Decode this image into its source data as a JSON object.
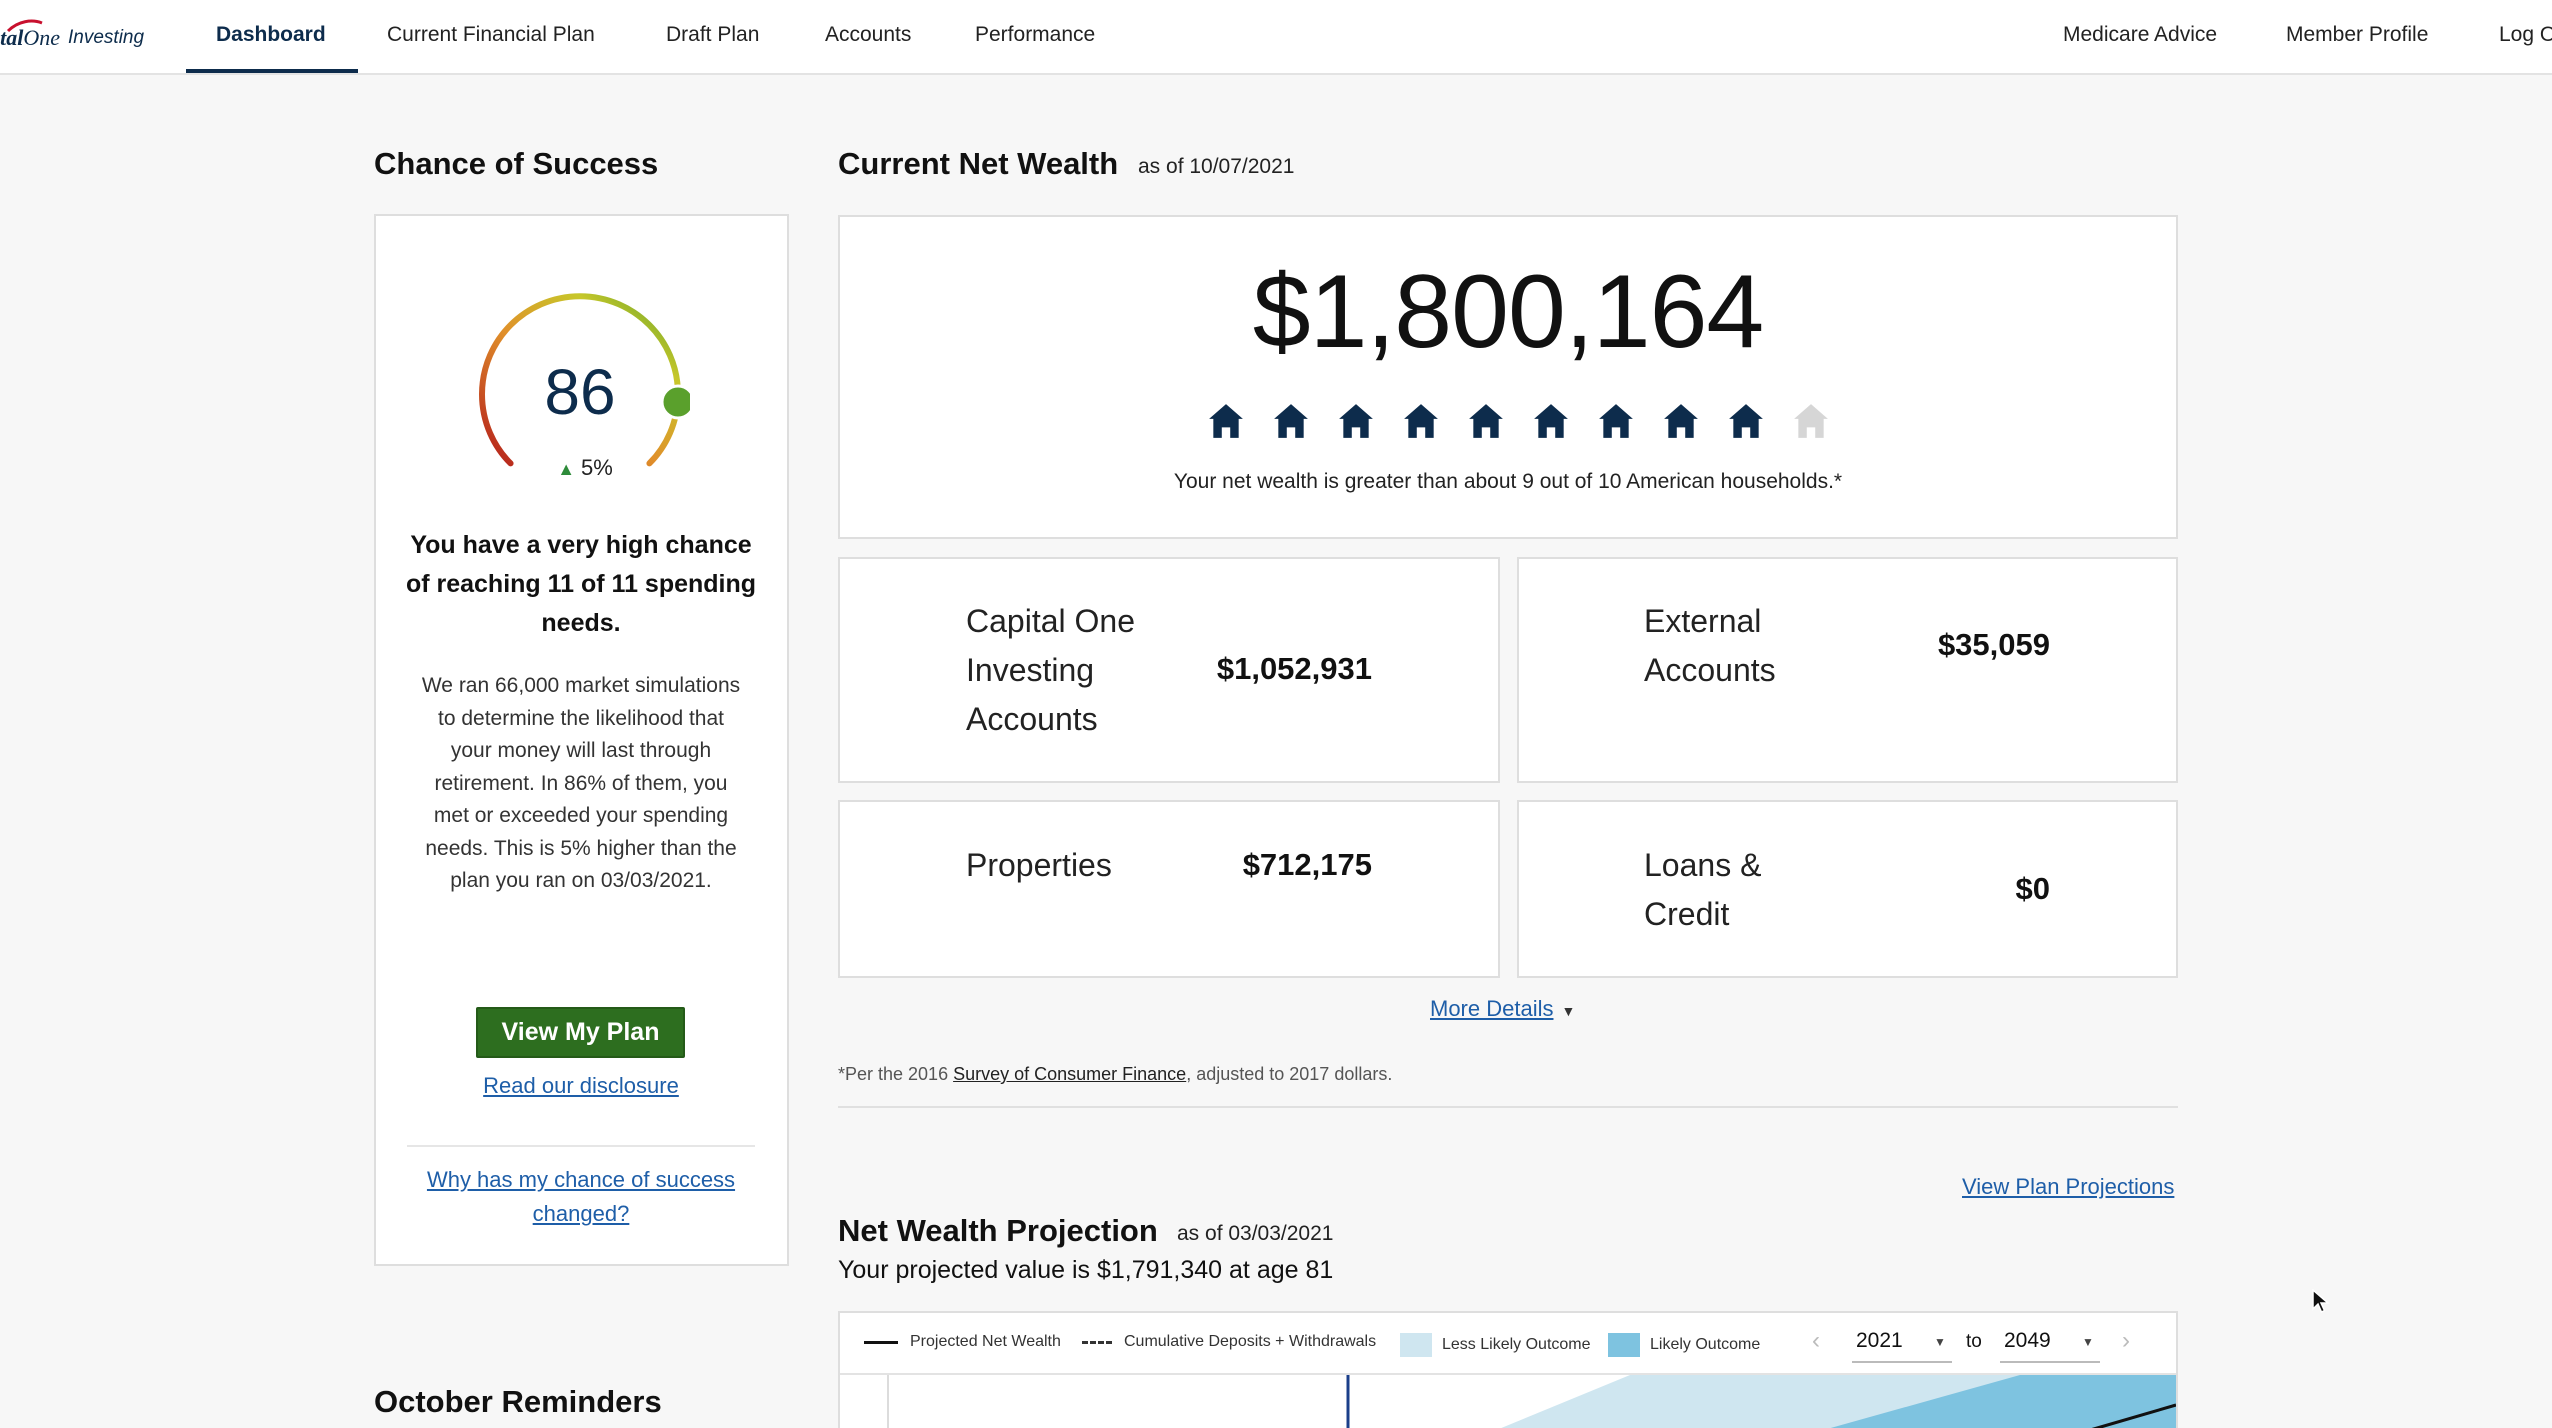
{
  "brand": {
    "logo_mark": "ital",
    "logo_mark2": "One",
    "logo_sub": "Investing"
  },
  "nav": {
    "items": [
      {
        "label": "Dashboard",
        "active": true
      },
      {
        "label": "Current Financial Plan"
      },
      {
        "label": "Draft Plan"
      },
      {
        "label": "Accounts"
      },
      {
        "label": "Performance"
      }
    ],
    "right_items": [
      {
        "label": "Medicare Advice"
      },
      {
        "label": "Member Profile"
      },
      {
        "label": "Log O"
      }
    ]
  },
  "success": {
    "title": "Chance of Success",
    "score": "86",
    "score_fraction": 0.86,
    "delta": "5%",
    "headline": "You have a very high chance of reaching 11 of 11 spending needs.",
    "body": "We ran 66,000 market simulations to determine the likelihood that your money will last through retirement. In 86% of them, you met or exceeded your spending needs. This is 5% higher than the plan you ran on 03/03/2021.",
    "button": "View My Plan",
    "disclosure_link": "Read our disclosure",
    "why_link": "Why has my chance of success changed?"
  },
  "net_wealth": {
    "title": "Current Net Wealth",
    "as_of": "as of 10/07/2021",
    "amount": "$1,800,164",
    "houses_filled": 9,
    "houses_total": 10,
    "note": "Your net wealth is greater than about 9 out of 10 American households.*",
    "tiles": [
      {
        "label": "Capital One Investing Accounts",
        "value": "$1,052,931"
      },
      {
        "label": "External Accounts",
        "value": "$35,059"
      },
      {
        "label": "Properties",
        "value": "$712,175"
      },
      {
        "label": "Loans & Credit",
        "value": "$0"
      }
    ],
    "more_details": "More Details",
    "footnote_pre": "*Per the 2016 ",
    "footnote_link": "Survey of Consumer Finance",
    "footnote_post": ", adjusted to 2017 dollars."
  },
  "projection": {
    "view_link": "View Plan Projections",
    "title": "Net Wealth Projection",
    "as_of": "as of 03/03/2021",
    "subtitle": "Your projected value is $1,791,340 at age 81",
    "legend": [
      {
        "label": "Projected Net Wealth",
        "style": "solid-line"
      },
      {
        "label": "Cumulative Deposits + Withdrawals",
        "style": "dashed-line"
      },
      {
        "label": "Less Likely Outcome",
        "color": "#cfe6f0"
      },
      {
        "label": "Likely Outcome",
        "color": "#7ec3e0"
      }
    ],
    "year_from": "2021",
    "to_label": "to",
    "year_to": "2049"
  },
  "reminders": {
    "title": "October Reminders"
  },
  "colors": {
    "brand_navy": "#0d2c4c",
    "button_green": "#2d6e1f",
    "link_blue": "#1e5ea8",
    "house_filled": "#0d2c4c",
    "house_empty": "#d6d6d6"
  }
}
